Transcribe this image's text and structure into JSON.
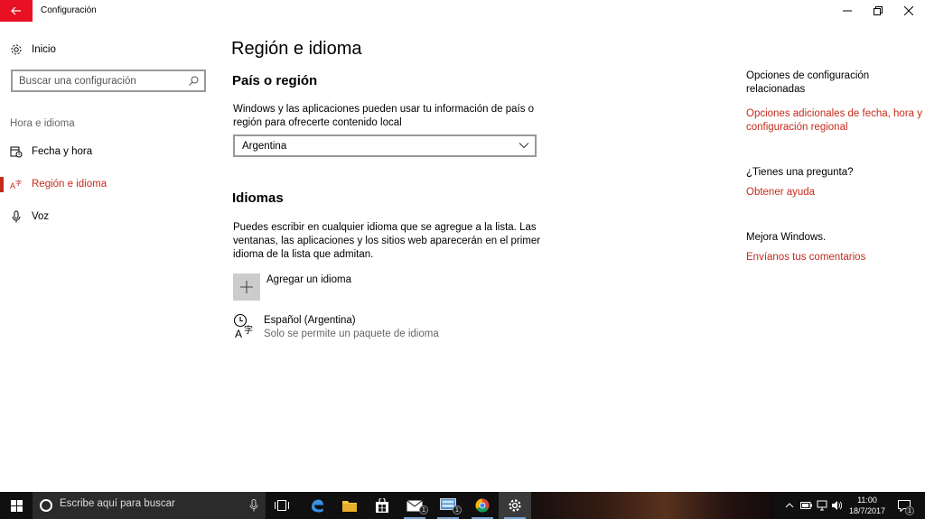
{
  "window": {
    "title": "Configuración",
    "controls": {
      "minimize": "minimize-icon",
      "maximize": "restore-icon",
      "close": "close-icon"
    }
  },
  "sidebar": {
    "home_label": "Inicio",
    "search_placeholder": "Buscar una configuración",
    "group_label": "Hora e idioma",
    "items": [
      {
        "label": "Fecha y hora",
        "icon": "calendar-clock-icon",
        "active": false
      },
      {
        "label": "Región e idioma",
        "icon": "language-icon",
        "active": true
      },
      {
        "label": "Voz",
        "icon": "microphone-icon",
        "active": false
      }
    ]
  },
  "main": {
    "title": "Región e idioma",
    "region_section": {
      "title": "País o región",
      "description": "Windows y las aplicaciones pueden usar tu información de país o región para ofrecerte contenido local",
      "selected_country": "Argentina"
    },
    "languages_section": {
      "title": "Idiomas",
      "description": "Puedes escribir en cualquier idioma que se agregue a la lista. Las ventanas, las aplicaciones y los sitios web aparecerán en el primer idioma de la lista que admitan.",
      "add_label": "Agregar un idioma",
      "languages": [
        {
          "name": "Español (Argentina)",
          "subtitle": "Solo se permite un paquete de idioma"
        }
      ]
    }
  },
  "related": {
    "heading": "Opciones de configuración relacionadas",
    "link_datetime": "Opciones adicionales de fecha, hora y configuración regional",
    "question_heading": "¿Tienes una pregunta?",
    "help_link": "Obtener ayuda",
    "improve_heading": "Mejora Windows.",
    "feedback_link": "Envíanos tus comentarios"
  },
  "taskbar": {
    "search_placeholder": "Escribe aquí para buscar",
    "mail_badge": "1",
    "app2_badge": "1",
    "notification_badge": "1",
    "time": "11:00",
    "date": "18/7/2017"
  },
  "colors": {
    "accent": "#c42b1c",
    "back_button": "#e81123",
    "taskbar": "#101010"
  }
}
